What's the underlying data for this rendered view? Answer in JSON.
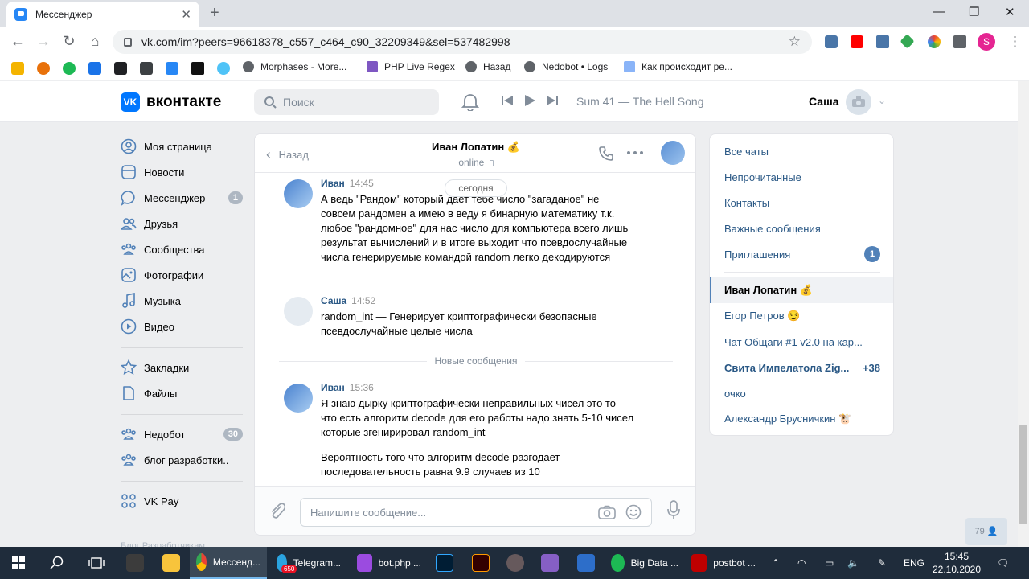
{
  "browser": {
    "tab_title": "Мессенджер",
    "url": "vk.com/im?peers=96618378_c557_c464_c90_32209349&sel=537482998",
    "profile_letter": "S",
    "bookmarks": [
      "Morphases - More...",
      "PHP Live Regex",
      "Назад",
      "Nedobot • Logs",
      "Как происходит ре..."
    ]
  },
  "vk": {
    "logo_text": "вконтакте",
    "logo_mark": "VK",
    "search_placeholder": "Поиск",
    "now_playing": "Sum 41 — The Hell Song",
    "user_name": "Саша"
  },
  "left_menu": [
    {
      "label": "Моя страница",
      "icon": "user-icon",
      "count": ""
    },
    {
      "label": "Новости",
      "icon": "news-icon",
      "count": ""
    },
    {
      "label": "Мессенджер",
      "icon": "messenger-icon",
      "count": "1"
    },
    {
      "label": "Друзья",
      "icon": "friends-icon",
      "count": ""
    },
    {
      "label": "Сообщества",
      "icon": "communities-icon",
      "count": ""
    },
    {
      "label": "Фотографии",
      "icon": "photos-icon",
      "count": ""
    },
    {
      "label": "Музыка",
      "icon": "music-icon",
      "count": ""
    },
    {
      "label": "Видео",
      "icon": "video-icon",
      "count": ""
    },
    {
      "label": "Закладки",
      "icon": "bookmarks-icon",
      "count": ""
    },
    {
      "label": "Файлы",
      "icon": "files-icon",
      "count": ""
    },
    {
      "label": "Недобот",
      "icon": "group-icon",
      "count": "30"
    },
    {
      "label": "блог разработки..",
      "icon": "group-icon",
      "count": ""
    },
    {
      "label": "VK Pay",
      "icon": "vkpay-icon",
      "count": ""
    }
  ],
  "chat": {
    "back_label": "Назад",
    "peer_name": "Иван Лопатин 💰",
    "peer_status": "online",
    "date_label": "сегодня",
    "new_messages_label": "Новые сообщения",
    "messages": [
      {
        "author": "Иван",
        "time": "14:45",
        "text": "А ведь \"Рандом\" который дает тебе число \"загаданое\" не совсем рандомен а имею в веду я бинарную математику т.к. любое \"рандомное\" для нас число для компьютера всего лишь результат вычислений и в итоге выходит что псевдослучайные числа генерируемые командой random легко декодируются"
      },
      {
        "author": "Саша",
        "time": "14:52",
        "text": "random_int — Генерирует криптографически безопасные псевдослучайные целые числа"
      },
      {
        "author": "Иван",
        "time": "15:36",
        "text": "Я знаю дырку криптографически неправильных чисел это то что есть алгоритм decode для его работы надо знать 5-10 чисел которые згенирировал random_int"
      },
      {
        "author": "",
        "time": "",
        "text": "Вероятность того что алгоритм decode разгодает последовательность равна 9.9 случаев из 10"
      }
    ],
    "input_placeholder": "Напишите сообщение..."
  },
  "right_panel": {
    "filters": [
      "Все чаты",
      "Непрочитанные",
      "Контакты",
      "Важные сообщения",
      "Приглашения"
    ],
    "invites_count": "1",
    "dialogs": [
      {
        "name": "Иван Лопатин 💰",
        "count": ""
      },
      {
        "name": "Егор Петров 😏",
        "count": ""
      },
      {
        "name": "Чат Общаги #1 v2.0 на кар...",
        "count": ""
      },
      {
        "name": "Свита Импелатола Zig...",
        "count": "+38"
      },
      {
        "name": "очко",
        "count": ""
      },
      {
        "name": "Александр Брусничкин 🐮",
        "count": ""
      }
    ]
  },
  "online_count": "79",
  "footer_text": "Блог  Разработчикам",
  "taskbar": {
    "items": [
      "Мессенд...",
      "Telegram...",
      "bot.php ...",
      "Big Data ...",
      "postbot ..."
    ],
    "telegram_badge": "650",
    "lang": "ENG",
    "time": "15:45",
    "date": "22.10.2020"
  },
  "colors": {
    "vk_blue": "#07f",
    "link": "#2a5885",
    "accent": "#5181b8"
  }
}
